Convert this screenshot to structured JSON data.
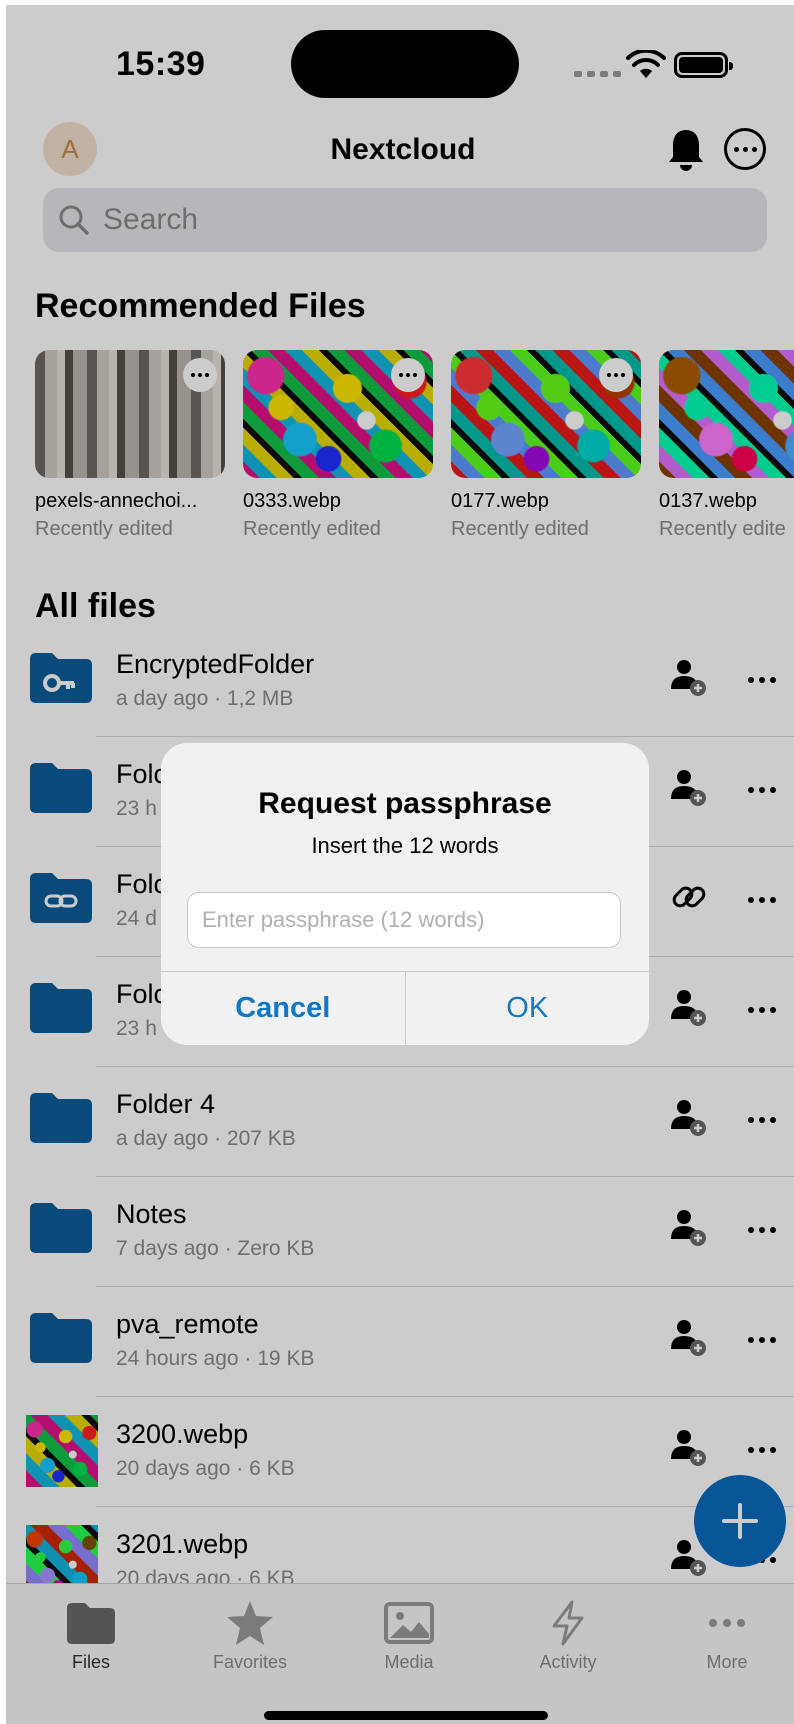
{
  "status": {
    "time": "15:39"
  },
  "header": {
    "avatar_letter": "A",
    "title": "Nextcloud"
  },
  "search": {
    "placeholder": "Search"
  },
  "recommended": {
    "title": "Recommended Files",
    "items": [
      {
        "name": "pexels-annechoi...",
        "sub": "Recently edited"
      },
      {
        "name": "0333.webp",
        "sub": "Recently edited"
      },
      {
        "name": "0177.webp",
        "sub": "Recently edited"
      },
      {
        "name": "0137.webp",
        "sub": "Recently edite"
      }
    ]
  },
  "all_files": {
    "title": "All files",
    "items": [
      {
        "name": "EncryptedFolder",
        "info": "a day ago · 1,2 MB",
        "icon": "encrypted-folder-icon",
        "share": "add-user-icon"
      },
      {
        "name": "Folc",
        "info": "23 h",
        "icon": "folder-icon",
        "share": "add-user-icon"
      },
      {
        "name": "Folc",
        "info": "24 d",
        "icon": "link-folder-icon",
        "share": "link-icon"
      },
      {
        "name": "Folc",
        "info": "23 h",
        "icon": "folder-icon",
        "share": "add-user-icon"
      },
      {
        "name": "Folder 4",
        "info": "a day ago · 207 KB",
        "icon": "folder-icon",
        "share": "add-user-icon"
      },
      {
        "name": "Notes",
        "info": "7 days ago · Zero KB",
        "icon": "folder-icon",
        "share": "add-user-icon"
      },
      {
        "name": "pva_remote",
        "info": "24 hours ago · 19 KB",
        "icon": "folder-icon",
        "share": "add-user-icon"
      },
      {
        "name": "3200.webp",
        "info": "20 days ago · 6 KB",
        "icon": "image-thumb",
        "share": "add-user-icon"
      },
      {
        "name": "3201.webp",
        "info": "20 days ago · 6 KB",
        "icon": "image-thumb",
        "share": "add-user-icon"
      }
    ]
  },
  "dialog": {
    "title": "Request passphrase",
    "message": "Insert the 12 words",
    "placeholder": "Enter passphrase (12 words)",
    "cancel": "Cancel",
    "ok": "OK"
  },
  "tabs": [
    {
      "label": "Files",
      "icon": "files-icon",
      "active": true
    },
    {
      "label": "Favorites",
      "icon": "star-icon"
    },
    {
      "label": "Media",
      "icon": "media-icon"
    },
    {
      "label": "Activity",
      "icon": "activity-icon"
    },
    {
      "label": "More",
      "icon": "more-icon"
    }
  ],
  "colors": {
    "accent": "#0b6bbf",
    "folder": "#0b5e9a",
    "secondary_text": "#8a8a8e"
  }
}
